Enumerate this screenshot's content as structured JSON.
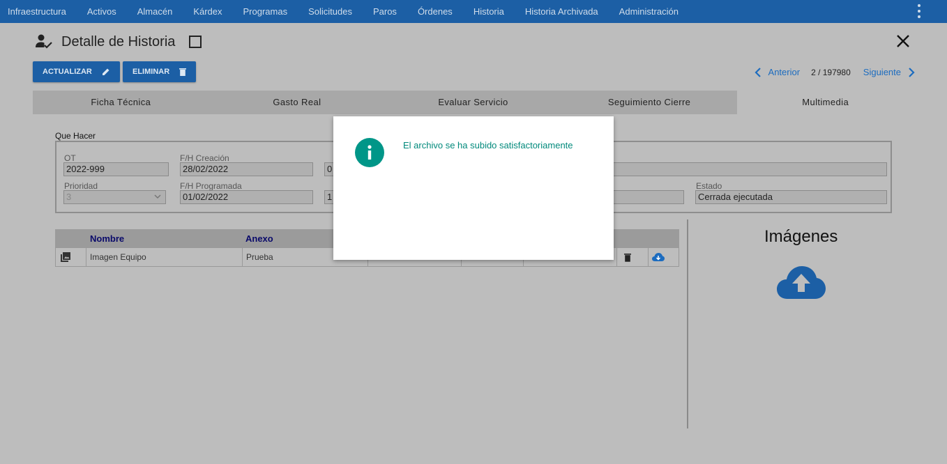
{
  "nav": {
    "items": [
      "Infraestructura",
      "Activos",
      "Almacén",
      "Kárdex",
      "Programas",
      "Solicitudes",
      "Paros",
      "Órdenes",
      "Historia",
      "Historia Archivada",
      "Administración"
    ]
  },
  "header": {
    "title": "Detalle de Historia"
  },
  "actions": {
    "update_label": "ACTUALIZAR",
    "delete_label": "ELIMINAR"
  },
  "pager": {
    "prev_label": "Anterior",
    "count": "2 / 197980",
    "next_label": "Siguiente"
  },
  "tabs": [
    {
      "label": "Ficha Técnica"
    },
    {
      "label": "Gasto Real"
    },
    {
      "label": "Evaluar Servicio"
    },
    {
      "label": "Seguimiento Cierre"
    },
    {
      "label": "Multimedia",
      "active": true
    }
  ],
  "form": {
    "section_label": "Que Hacer",
    "ot_label": "OT",
    "ot_value": "2022-999",
    "creacion_label": "F/H Creación",
    "creacion_value": "28/02/2022",
    "creacion_time": "0",
    "prioridad_label": "Prioridad",
    "prioridad_value": "3",
    "programada_label": "F/H Programada",
    "programada_value": "01/02/2022",
    "programada_time": "1",
    "estado_label": "Estado",
    "estado_value": "Cerrada ejecutada"
  },
  "attachments": {
    "columns": [
      "Nombre",
      "Anexo"
    ],
    "rows": [
      {
        "nombre": "Imagen Equipo",
        "anexo": "Prueba"
      }
    ]
  },
  "images": {
    "title": "Imágenes"
  },
  "modal": {
    "message": "El archivo se ha subido satisfactoriamente"
  },
  "colors": {
    "nav_bg": "#1c5fa5",
    "accent": "#1c6cbf",
    "info": "#009688"
  }
}
